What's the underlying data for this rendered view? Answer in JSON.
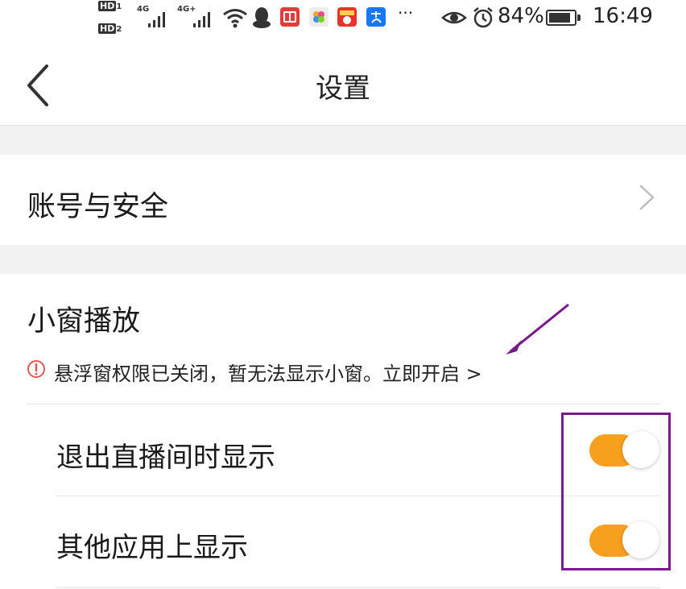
{
  "status_bar": {
    "hd1": "HD",
    "hd1_sub": "1",
    "hd2": "HD",
    "hd2_sub": "2",
    "net1": "4G",
    "net2": "4G+",
    "more": "···",
    "battery": "84%",
    "time": "16:49"
  },
  "nav": {
    "title": "设置"
  },
  "account": {
    "label": "账号与安全"
  },
  "floating": {
    "title": "小窗播放",
    "warning": "悬浮窗权限已关闭，暂无法显示小窗。立即开启 >",
    "items": [
      {
        "label": "退出直播间时显示",
        "enabled": true
      },
      {
        "label": "其他应用上显示",
        "enabled": true
      }
    ]
  },
  "colors": {
    "toggle_on": "#f7a01d",
    "annotation": "#7b1a8c",
    "warning_icon": "#e05a50"
  }
}
